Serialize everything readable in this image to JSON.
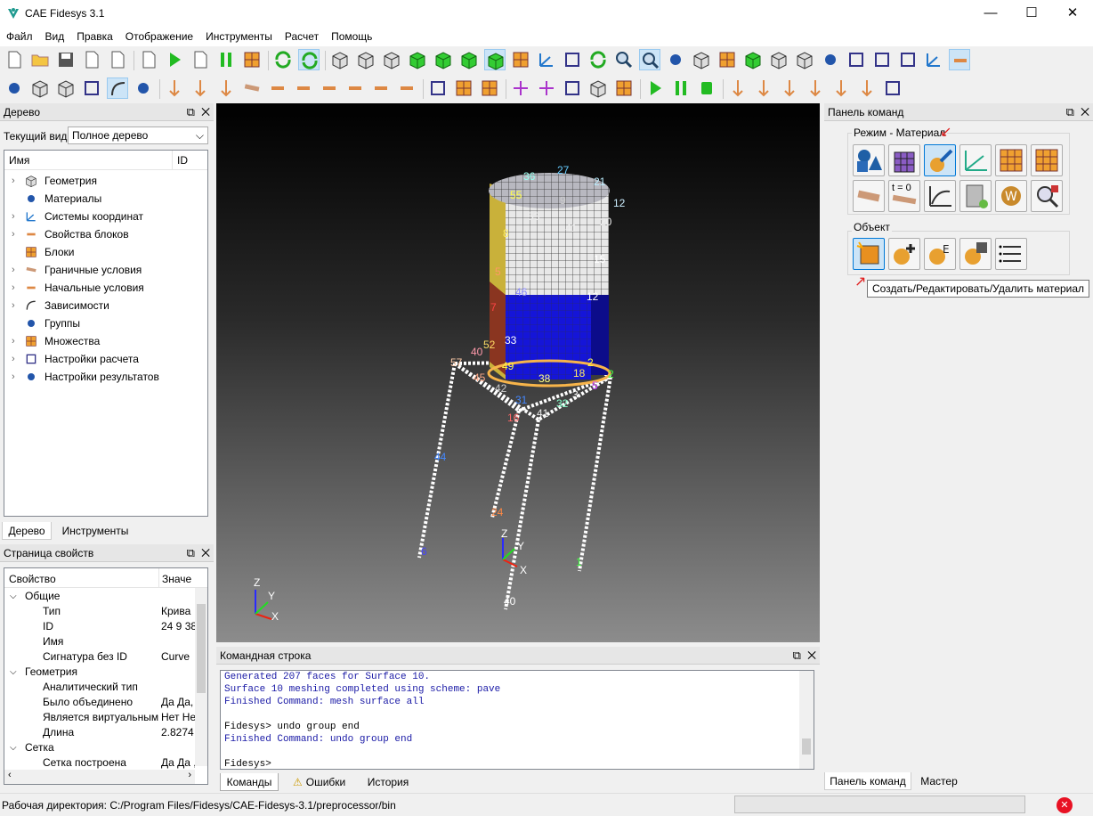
{
  "app": {
    "title": "CAE Fidesys 3.1",
    "min": "—",
    "max": "☐",
    "close": "✕"
  },
  "menu": [
    "Файл",
    "Вид",
    "Правка",
    "Отображение",
    "Инструменты",
    "Расчет",
    "Помощь"
  ],
  "tree_panel": {
    "title": "Дерево",
    "current_view_label": "Текущий вид",
    "current_view_value": "Полное дерево",
    "col_name": "Имя",
    "col_id": "ID",
    "items": [
      {
        "label": "Геометрия",
        "icon": "geometry-icon",
        "expandable": true
      },
      {
        "label": "Материалы",
        "icon": "materials-icon",
        "expandable": false
      },
      {
        "label": "Системы координат",
        "icon": "coordinate-systems-icon",
        "expandable": true
      },
      {
        "label": "Свойства блоков",
        "icon": "block-properties-icon",
        "expandable": true
      },
      {
        "label": "Блоки",
        "icon": "blocks-icon",
        "expandable": false
      },
      {
        "label": "Граничные условия",
        "icon": "boundary-conditions-icon",
        "expandable": true
      },
      {
        "label": "Начальные условия",
        "icon": "initial-conditions-icon",
        "expandable": true
      },
      {
        "label": "Зависимости",
        "icon": "dependencies-icon",
        "expandable": true
      },
      {
        "label": "Группы",
        "icon": "groups-icon",
        "expandable": false
      },
      {
        "label": "Множества",
        "icon": "sets-icon",
        "expandable": true
      },
      {
        "label": "Настройки расчета",
        "icon": "calc-settings-icon",
        "expandable": true
      },
      {
        "label": "Настройки результатов",
        "icon": "results-settings-icon",
        "expandable": true
      }
    ],
    "tabs": [
      "Дерево",
      "Инструменты"
    ]
  },
  "props_panel": {
    "title": "Страница свойств",
    "col_prop": "Свойство",
    "col_val": "Значе",
    "rows": [
      {
        "kind": "group",
        "label": "Общие"
      },
      {
        "kind": "row",
        "label": "Тип",
        "value": "Крива"
      },
      {
        "kind": "row",
        "label": "ID",
        "value": "24 9 38"
      },
      {
        "kind": "row",
        "label": "Имя",
        "value": ""
      },
      {
        "kind": "row",
        "label": "Сигнатура без ID",
        "value": "Curve"
      },
      {
        "kind": "group",
        "label": "Геометрия"
      },
      {
        "kind": "row",
        "label": "Аналитический тип",
        "value": ""
      },
      {
        "kind": "row",
        "label": "Было объединено",
        "value": "Да Да,"
      },
      {
        "kind": "row",
        "label": "Является виртуальным",
        "value": "Нет Не"
      },
      {
        "kind": "row",
        "label": "Длина",
        "value": "2.8274"
      },
      {
        "kind": "group",
        "label": "Сетка"
      },
      {
        "kind": "row",
        "label": "Сетка построена",
        "value": "Да Да ,"
      }
    ]
  },
  "cmdline": {
    "title": "Командная строка",
    "lines": [
      {
        "text": "Generated 207 faces for Surface 10.",
        "color": "#1a1aa6"
      },
      {
        "text": "Surface 10 meshing completed using scheme: pave",
        "color": "#1a1aa6"
      },
      {
        "text": "Finished Command: mesh surface all",
        "color": "#1a1aa6"
      },
      {
        "text": "",
        "color": "#000"
      },
      {
        "text": "Fidesys> undo group end",
        "color": "#000"
      },
      {
        "text": "Finished Command: undo group end",
        "color": "#1a1aa6"
      },
      {
        "text": "",
        "color": "#000"
      },
      {
        "text": "Fidesys>",
        "color": "#000"
      }
    ],
    "tabs": [
      "Команды",
      "Ошибки",
      "История"
    ]
  },
  "cmd_panel": {
    "title": "Панель команд",
    "mode_label": "Режим - Материал",
    "object_label": "Объект",
    "tooltip": "Создать/Редактировать/Удалить материал",
    "t0_label": "t = 0",
    "tabs": [
      "Панель команд",
      "Мастер"
    ]
  },
  "status": {
    "text": "Рабочая директория: C:/Program Files/Fidesys/CAE-Fidesys-3.1/preprocessor/bin"
  },
  "viewport": {
    "labels": [
      {
        "t": "36",
        "c": "#9fe"
      },
      {
        "t": "27",
        "c": "#6cf"
      },
      {
        "t": "21",
        "c": "#bef"
      },
      {
        "t": "12",
        "c": "#cef"
      },
      {
        "t": "55",
        "c": "#ff4"
      },
      {
        "t": "9",
        "c": "#ccc"
      },
      {
        "t": "53",
        "c": "#eee"
      },
      {
        "t": "41",
        "c": "#eee"
      },
      {
        "t": "20",
        "c": "#eee"
      },
      {
        "t": "8",
        "c": "#fe6"
      },
      {
        "t": "15",
        "c": "#fff"
      },
      {
        "t": "5",
        "c": "#f96"
      },
      {
        "t": "46",
        "c": "#88f"
      },
      {
        "t": "12",
        "c": "#fff"
      },
      {
        "t": "7",
        "c": "#f44"
      },
      {
        "t": "52",
        "c": "#fd6"
      },
      {
        "t": "33",
        "c": "#fff"
      },
      {
        "t": "40",
        "c": "#f9a"
      },
      {
        "t": "57",
        "c": "#fca"
      },
      {
        "t": "45",
        "c": "#fa8"
      },
      {
        "t": "49",
        "c": "#ff4"
      },
      {
        "t": "38",
        "c": "#ff8"
      },
      {
        "t": "18",
        "c": "#fe6"
      },
      {
        "t": "2",
        "c": "#ff4"
      },
      {
        "t": "2",
        "c": "#4f4"
      },
      {
        "t": "42",
        "c": "#ccc"
      },
      {
        "t": "31",
        "c": "#48f"
      },
      {
        "t": "3",
        "c": "#fff"
      },
      {
        "t": "5",
        "c": "#c4f"
      },
      {
        "t": "32",
        "c": "#8fc"
      },
      {
        "t": "16",
        "c": "#f66"
      },
      {
        "t": "41",
        "c": "#eee"
      },
      {
        "t": "44",
        "c": "#48f"
      },
      {
        "t": "24",
        "c": "#f84"
      },
      {
        "t": "1",
        "c": "#4f4"
      },
      {
        "t": "40",
        "c": "#fff"
      },
      {
        "t": "6",
        "c": "#44f"
      }
    ],
    "axes": {
      "x": "X",
      "y": "Y",
      "z": "Z"
    }
  }
}
